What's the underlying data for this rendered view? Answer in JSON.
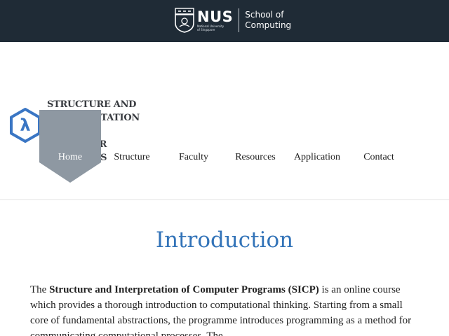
{
  "topbar": {
    "logo_name": "NUS",
    "logo_sub1": "National University",
    "logo_sub2": "of Singapore",
    "school_line1": "School of",
    "school_line2": "Computing",
    "background": "#1f2b36"
  },
  "site": {
    "title_lines": [
      "STRUCTURE AND",
      "INTERPRETATION OF",
      "COMPUTER",
      "PROGRAMS"
    ],
    "logo_glyph": "λ",
    "logo_color": "#3a76c4"
  },
  "nav": {
    "items": [
      {
        "label": "Home",
        "active": true
      },
      {
        "label": "Structure",
        "active": false
      },
      {
        "label": "Faculty",
        "active": false
      },
      {
        "label": "Resources",
        "active": false
      },
      {
        "label": "Application",
        "active": false
      },
      {
        "label": "Contact",
        "active": false
      }
    ],
    "active_color": "#8e98a2"
  },
  "main": {
    "heading": "Introduction",
    "heading_color": "#3273b8",
    "para_prefix": "The ",
    "para_bold": "Structure and Interpretation of Computer Programs (SICP)",
    "para_rest": " is an online course which provides a thorough introduction to computational thinking. Starting from a small core of fundamental abstractions, the programme introduces programming as a method for communicating computational processes. The"
  }
}
